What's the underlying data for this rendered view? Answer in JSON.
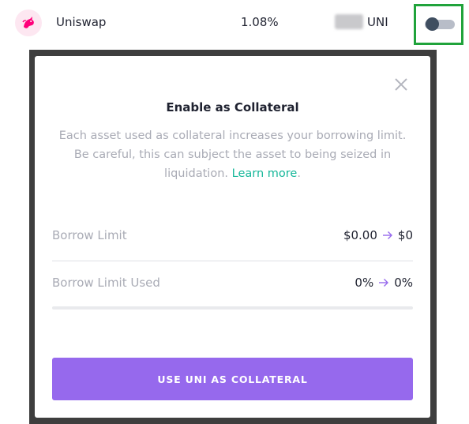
{
  "asset_row": {
    "name": "Uniswap",
    "apy": "1.08%",
    "balance_symbol": "UNI",
    "logo_icon": "uniswap-unicorn-icon",
    "collateral_toggle_on": false
  },
  "modal": {
    "title": "Enable as Collateral",
    "description": "Each asset used as collateral increases your borrowing limit. Be careful, this can subject the asset to being seized in liquidation.",
    "learn_more": "Learn more",
    "learn_more_suffix": ".",
    "close_icon": "close-icon",
    "borrow_limit": {
      "label": "Borrow Limit",
      "from": "$0.00",
      "to": "$0"
    },
    "borrow_limit_used": {
      "label": "Borrow Limit Used",
      "from": "0%",
      "to": "0%",
      "progress_fraction": 0
    },
    "button_label": "USE UNI AS COLLATERAL"
  },
  "colors": {
    "accent": "#9669ed",
    "link": "#16b79a",
    "highlight": "#20a33b",
    "muted_text": "#a9abb5",
    "text": "#1f2230"
  }
}
